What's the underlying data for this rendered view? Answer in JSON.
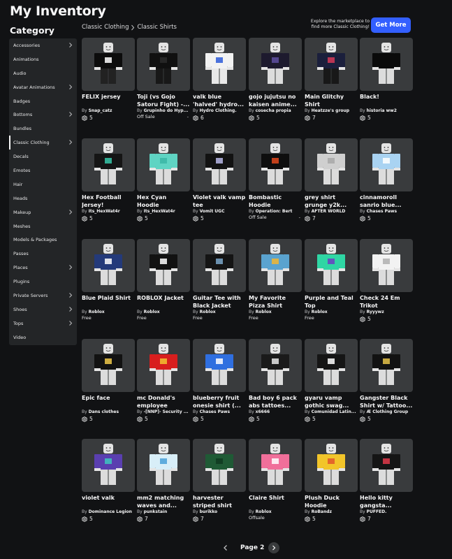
{
  "header": {
    "title": "My Inventory",
    "category_heading": "Category"
  },
  "breadcrumb": {
    "parent": "Classic Clothing",
    "current": "Classic Shirts"
  },
  "promo": {
    "line1": "Explore the marketplace to",
    "line2": "find more Classic Clothing!",
    "button": "Get More"
  },
  "sidebar": {
    "items": [
      {
        "label": "Accessories",
        "chevron": true
      },
      {
        "label": "Animations",
        "chevron": false
      },
      {
        "label": "Audio",
        "chevron": false
      },
      {
        "label": "Avatar Animations",
        "chevron": true
      },
      {
        "label": "Badges",
        "chevron": false
      },
      {
        "label": "Bottoms",
        "chevron": true
      },
      {
        "label": "Bundles",
        "chevron": false
      },
      {
        "label": "Classic Clothing",
        "chevron": true,
        "active": true
      },
      {
        "label": "Decals",
        "chevron": false
      },
      {
        "label": "Emotes",
        "chevron": false
      },
      {
        "label": "Hair",
        "chevron": false
      },
      {
        "label": "Heads",
        "chevron": false
      },
      {
        "label": "Makeup",
        "chevron": true
      },
      {
        "label": "Meshes",
        "chevron": false
      },
      {
        "label": "Models & Packages",
        "chevron": false
      },
      {
        "label": "Passes",
        "chevron": false
      },
      {
        "label": "Places",
        "chevron": true
      },
      {
        "label": "Plugins",
        "chevron": false
      },
      {
        "label": "Private Servers",
        "chevron": true
      },
      {
        "label": "Shoes",
        "chevron": true
      },
      {
        "label": "Tops",
        "chevron": true
      },
      {
        "label": "Video",
        "chevron": false
      }
    ]
  },
  "items": [
    {
      "name": "FELIX jersey",
      "creator": "Snap_catz",
      "price": "5",
      "shirt": "#0c0c0c",
      "accent": "#ffffff",
      "pants": "#222222"
    },
    {
      "name": "Toji (vs Gojo Satoru Fight) -...",
      "creator": "Grupinho do Hyp...",
      "status": "Off Sale",
      "dot": "-",
      "shirt": "#101010",
      "accent": "#2a2a2a",
      "pants": "#181818"
    },
    {
      "name": "valk blue 'halved' hydro...",
      "creator": "Hydro Clothing.",
      "price": "6",
      "shirt": "#f2f2f2",
      "accent": "#2d5bd8",
      "pants": "#e8e8e8"
    },
    {
      "name": "gojo jujutsu no kaisen anime...",
      "creator": "cosecha propia",
      "price": "5",
      "shirt": "#1d1a2e",
      "accent": "#5e4fa0",
      "pants": "#dcdcdc"
    },
    {
      "name": "Main Glitchy Shirt",
      "creator": "Heatzze's group",
      "price": "7",
      "shirt": "#1b1f3c",
      "accent": "#d63a57",
      "pants": "#181818"
    },
    {
      "name": "Black!",
      "creator": "historia ww2",
      "price": "5",
      "shirt": "#0a0a0a",
      "accent": "#0a0a0a",
      "pants": "#dcdcdc"
    },
    {
      "name": "Hex Football Jersey!",
      "creator": "Its_HexWat4r",
      "price": "5",
      "shirt": "#151515",
      "accent": "#37c7a9",
      "pants": "#dcdcdc"
    },
    {
      "name": "Hex Cyan Hoodie",
      "creator": "Its_HexWat4r",
      "price": "5",
      "shirt": "#5fd4c3",
      "accent": "#3bb6a6",
      "pants": "#dcdcdc"
    },
    {
      "name": "Violet valk vamp tee",
      "creator": "Vomit UGC",
      "price": "5",
      "shirt": "#121212",
      "accent": "#b9b9e8",
      "pants": "#dcdcdc"
    },
    {
      "name": "Bombastic Hoodie",
      "creator": "Operation: Bert",
      "status": "Off Sale",
      "dot": "-",
      "shirt": "#0e0e0e",
      "accent": "#e0481c",
      "pants": "#dcdcdc"
    },
    {
      "name": "grey shirt grunge y2k...",
      "creator": "AFTER WORLD",
      "price": "7",
      "shirt": "#cfcfcf",
      "accent": "#a8a8a8",
      "pants": "#dcdcdc"
    },
    {
      "name": "cinnamoroll sanrio blue...",
      "creator": "Chases Paws",
      "price": "5",
      "shirt": "#a9d3f2",
      "accent": "#ffffff",
      "pants": "#dcdcdc"
    },
    {
      "name": "Blue Plaid Shirt",
      "creator": "Roblox",
      "status": "Free",
      "shirt": "#243a7a",
      "accent": "#ffffff",
      "pants": "#dcdcdc"
    },
    {
      "name": "ROBLOX Jacket",
      "creator": "Roblox",
      "status": "Free",
      "shirt": "#121212",
      "accent": "#ffffff",
      "pants": "#dcdcdc"
    },
    {
      "name": "Guitar Tee with Black Jacket",
      "creator": "Roblox",
      "status": "Free",
      "shirt": "#141414",
      "accent": "#7aa6c9",
      "pants": "#dcdcdc"
    },
    {
      "name": "My Favorite Pizza Shirt",
      "creator": "Roblox",
      "status": "Free",
      "shirt": "#5aa3cf",
      "accent": "#f2b630",
      "pants": "#dcdcdc"
    },
    {
      "name": "Purple and Teal Top",
      "creator": "Roblox",
      "status": "Free",
      "shirt": "#2fd6a4",
      "accent": "#6a3fc3",
      "pants": "#dcdcdc"
    },
    {
      "name": "Check 24 Em Trikot",
      "creator": "Ryyywz",
      "price": "5",
      "shirt": "#f2f2f2",
      "accent": "#b0b0b0",
      "pants": "#dcdcdc"
    },
    {
      "name": "Epic face",
      "creator": "Dans clothes",
      "price": "5",
      "shirt": "#121212",
      "accent": "#f0c94a",
      "pants": "#dcdcdc"
    },
    {
      "name": "mc Donald's employee",
      "creator": "-[NNP]- Security ...",
      "price": "5",
      "shirt": "#d81e1e",
      "accent": "#f2c230",
      "pants": "#dcdcdc"
    },
    {
      "name": "blueberry fruit onesie shirt (...",
      "creator": "Chases Paws",
      "price": "5",
      "shirt": "#2f6fe0",
      "accent": "#ffffff",
      "pants": "#dcdcdc"
    },
    {
      "name": "Bad boy 6 pack abs tattoes...",
      "creator": "x6666",
      "price": "5",
      "shirt": "#1a1a1a",
      "accent": "#e8e8e8",
      "pants": "#dcdcdc"
    },
    {
      "name": "gyaru vamp gothic swag...",
      "creator": "Comunidad Latin...",
      "price": "5",
      "shirt": "#151515",
      "accent": "#ffffff",
      "pants": "#dcdcdc"
    },
    {
      "name": "Gangster Black Shirt w/ Tattoo...",
      "creator": "Æ Clothing Group",
      "price": "5",
      "shirt": "#121212",
      "accent": "#e6c34a",
      "pants": "#dcdcdc"
    },
    {
      "name": "violet valk",
      "creator": "Dominance Legion",
      "price": "5",
      "shirt": "#5a3fb0",
      "accent": "#3ec6c0",
      "pants": "#dcdcdc"
    },
    {
      "name": "mm2 matching waves and...",
      "creator": "punkstain",
      "price": "7",
      "shirt": "#d8eef8",
      "accent": "#4aa0d8",
      "pants": "#dcdcdc"
    },
    {
      "name": "harvester striped shirt",
      "creator": "burikko",
      "price": "7",
      "shirt": "#1f5a35",
      "accent": "#0f3a20",
      "pants": "#dcdcdc"
    },
    {
      "name": "Claire Shirt",
      "creator": "Roblox",
      "status": "Offsale",
      "shirt": "#f06f9a",
      "accent": "#ffffff",
      "pants": "#dcdcdc"
    },
    {
      "name": "Plush Duck Hoodie",
      "creator": "RoBandz",
      "price": "5",
      "shirt": "#f2c52a",
      "accent": "#e2562a",
      "pants": "#dcdcdc"
    },
    {
      "name": "Hello kitty gangsta...",
      "creator": "PUFFED.",
      "price": "7",
      "shirt": "#151515",
      "accent": "#e03a4a",
      "pants": "#dcdcdc"
    }
  ],
  "labels": {
    "by": "By"
  },
  "pagination": {
    "label": "Page 2"
  }
}
